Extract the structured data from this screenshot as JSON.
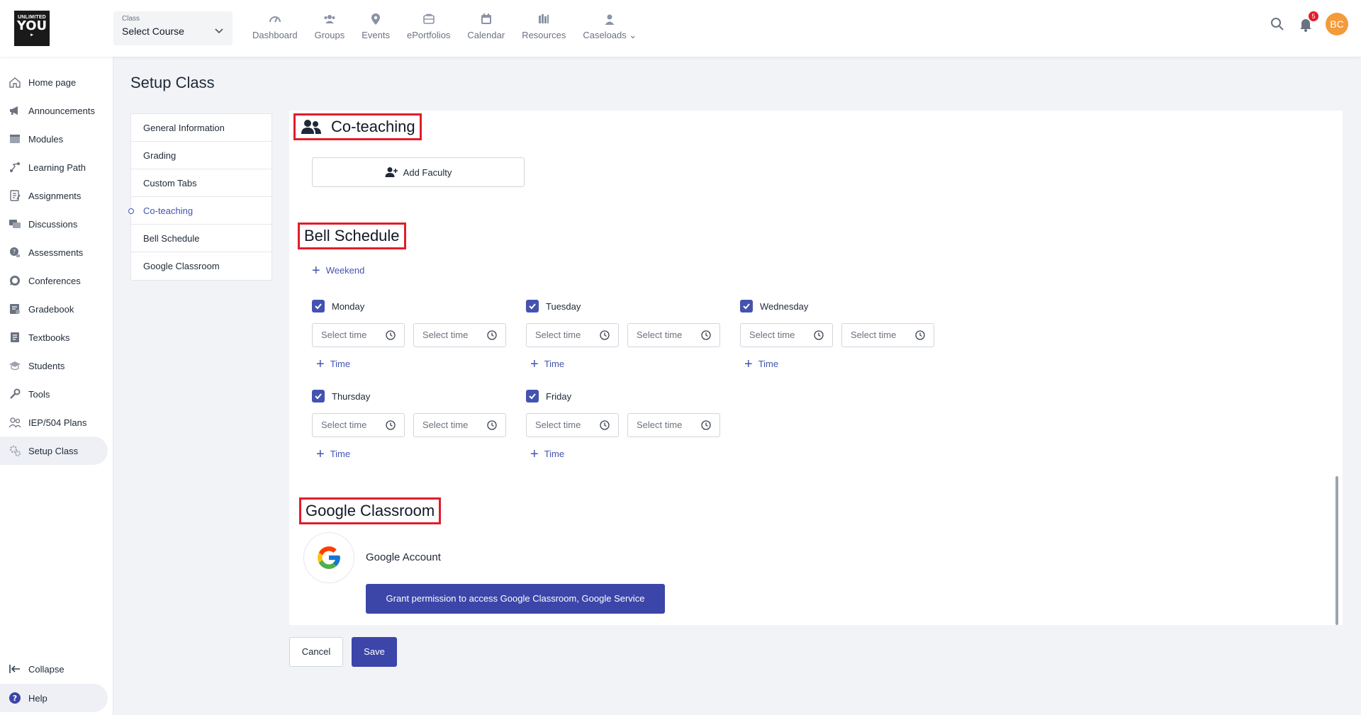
{
  "header": {
    "logo": {
      "line1": "UNLIMITED",
      "line2": "YOU"
    },
    "course": {
      "caption": "Class",
      "value": "Select Course"
    },
    "nav": [
      {
        "label": "Dashboard",
        "icon": "dashboard-icon"
      },
      {
        "label": "Groups",
        "icon": "groups-icon"
      },
      {
        "label": "Events",
        "icon": "events-icon"
      },
      {
        "label": "ePortfolios",
        "icon": "eportfolios-icon"
      },
      {
        "label": "Calendar",
        "icon": "calendar-icon"
      },
      {
        "label": "Resources",
        "icon": "resources-icon"
      },
      {
        "label": "Caseloads",
        "icon": "caseloads-icon"
      }
    ],
    "notification_count": "5",
    "avatar_initials": "BC"
  },
  "sidebar": {
    "items": [
      {
        "label": "Home page",
        "icon": "home-icon"
      },
      {
        "label": "Announcements",
        "icon": "megaphone-icon"
      },
      {
        "label": "Modules",
        "icon": "modules-icon"
      },
      {
        "label": "Learning Path",
        "icon": "learning-path-icon"
      },
      {
        "label": "Assignments",
        "icon": "assignments-icon"
      },
      {
        "label": "Discussions",
        "icon": "discussions-icon"
      },
      {
        "label": "Assessments",
        "icon": "assessments-icon"
      },
      {
        "label": "Conferences",
        "icon": "conferences-icon"
      },
      {
        "label": "Gradebook",
        "icon": "gradebook-icon"
      },
      {
        "label": "Textbooks",
        "icon": "textbooks-icon"
      },
      {
        "label": "Students",
        "icon": "students-icon"
      },
      {
        "label": "Tools",
        "icon": "tools-icon"
      },
      {
        "label": "IEP/504 Plans",
        "icon": "iep-plans-icon"
      },
      {
        "label": "Setup Class",
        "icon": "setup-class-icon"
      }
    ],
    "collapse_label": "Collapse",
    "help_label": "Help"
  },
  "page": {
    "title": "Setup Class",
    "subnav": [
      "General Information",
      "Grading",
      "Custom Tabs",
      "Co-teaching",
      "Bell Schedule",
      "Google Classroom"
    ]
  },
  "coteaching": {
    "title": "Co-teaching",
    "add_faculty_label": "Add Faculty"
  },
  "bell_schedule": {
    "title": "Bell Schedule",
    "weekend_label": "Weekend",
    "time_placeholder": "Select time",
    "add_time_label": "Time",
    "days": [
      "Monday",
      "Tuesday",
      "Wednesday",
      "Thursday",
      "Friday"
    ]
  },
  "google_classroom": {
    "title": "Google Classroom",
    "account_label": "Google Account",
    "grant_label": "Grant permission to access Google Classroom, Google Service"
  },
  "actions": {
    "cancel_label": "Cancel",
    "save_label": "Save"
  },
  "colors": {
    "accent": "#3c45a8",
    "highlight": "#e11d2a",
    "avatar": "#f39a3a"
  }
}
